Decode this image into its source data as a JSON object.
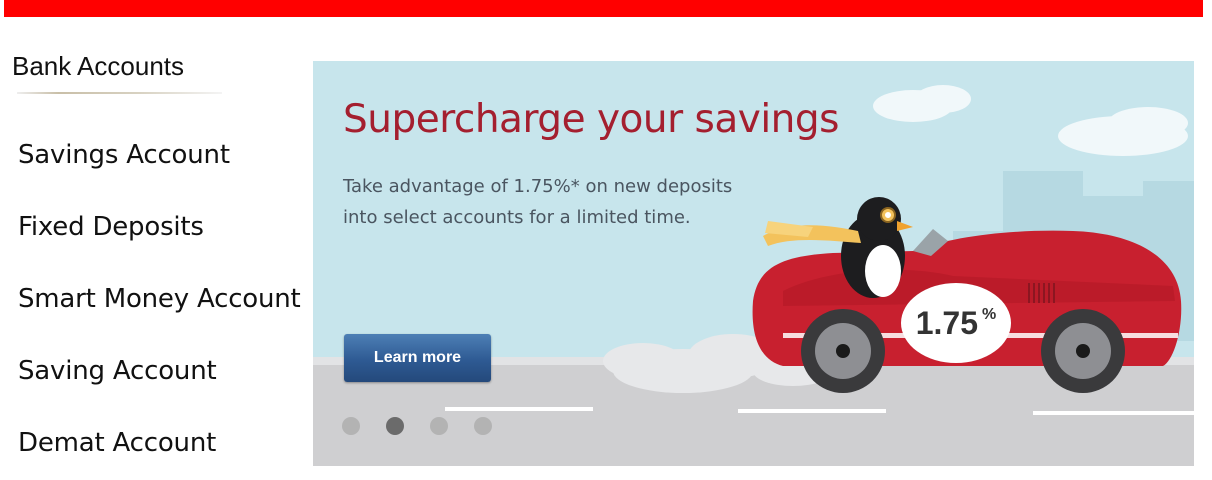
{
  "sidebar": {
    "title": "Bank Accounts",
    "items": [
      {
        "label": "Savings Account"
      },
      {
        "label": "Fixed Deposits"
      },
      {
        "label": "Smart Money Account"
      },
      {
        "label": "Saving Account"
      },
      {
        "label": "Demat Account"
      }
    ]
  },
  "banner": {
    "headline": "Supercharge your savings",
    "subtext": "Take advantage of 1.75%* on new deposits into select accounts for a limited time.",
    "cta_label": "Learn more",
    "rate_value": "1.75",
    "rate_unit": "%",
    "carousel_dots": {
      "count": 4,
      "active_index": 1
    }
  },
  "colors": {
    "top_bar": "#ff0000",
    "headline": "#a41f2f",
    "cta_button": "#2e5a93",
    "banner_sky": "#c7e5ec",
    "car_body": "#c8202f"
  }
}
